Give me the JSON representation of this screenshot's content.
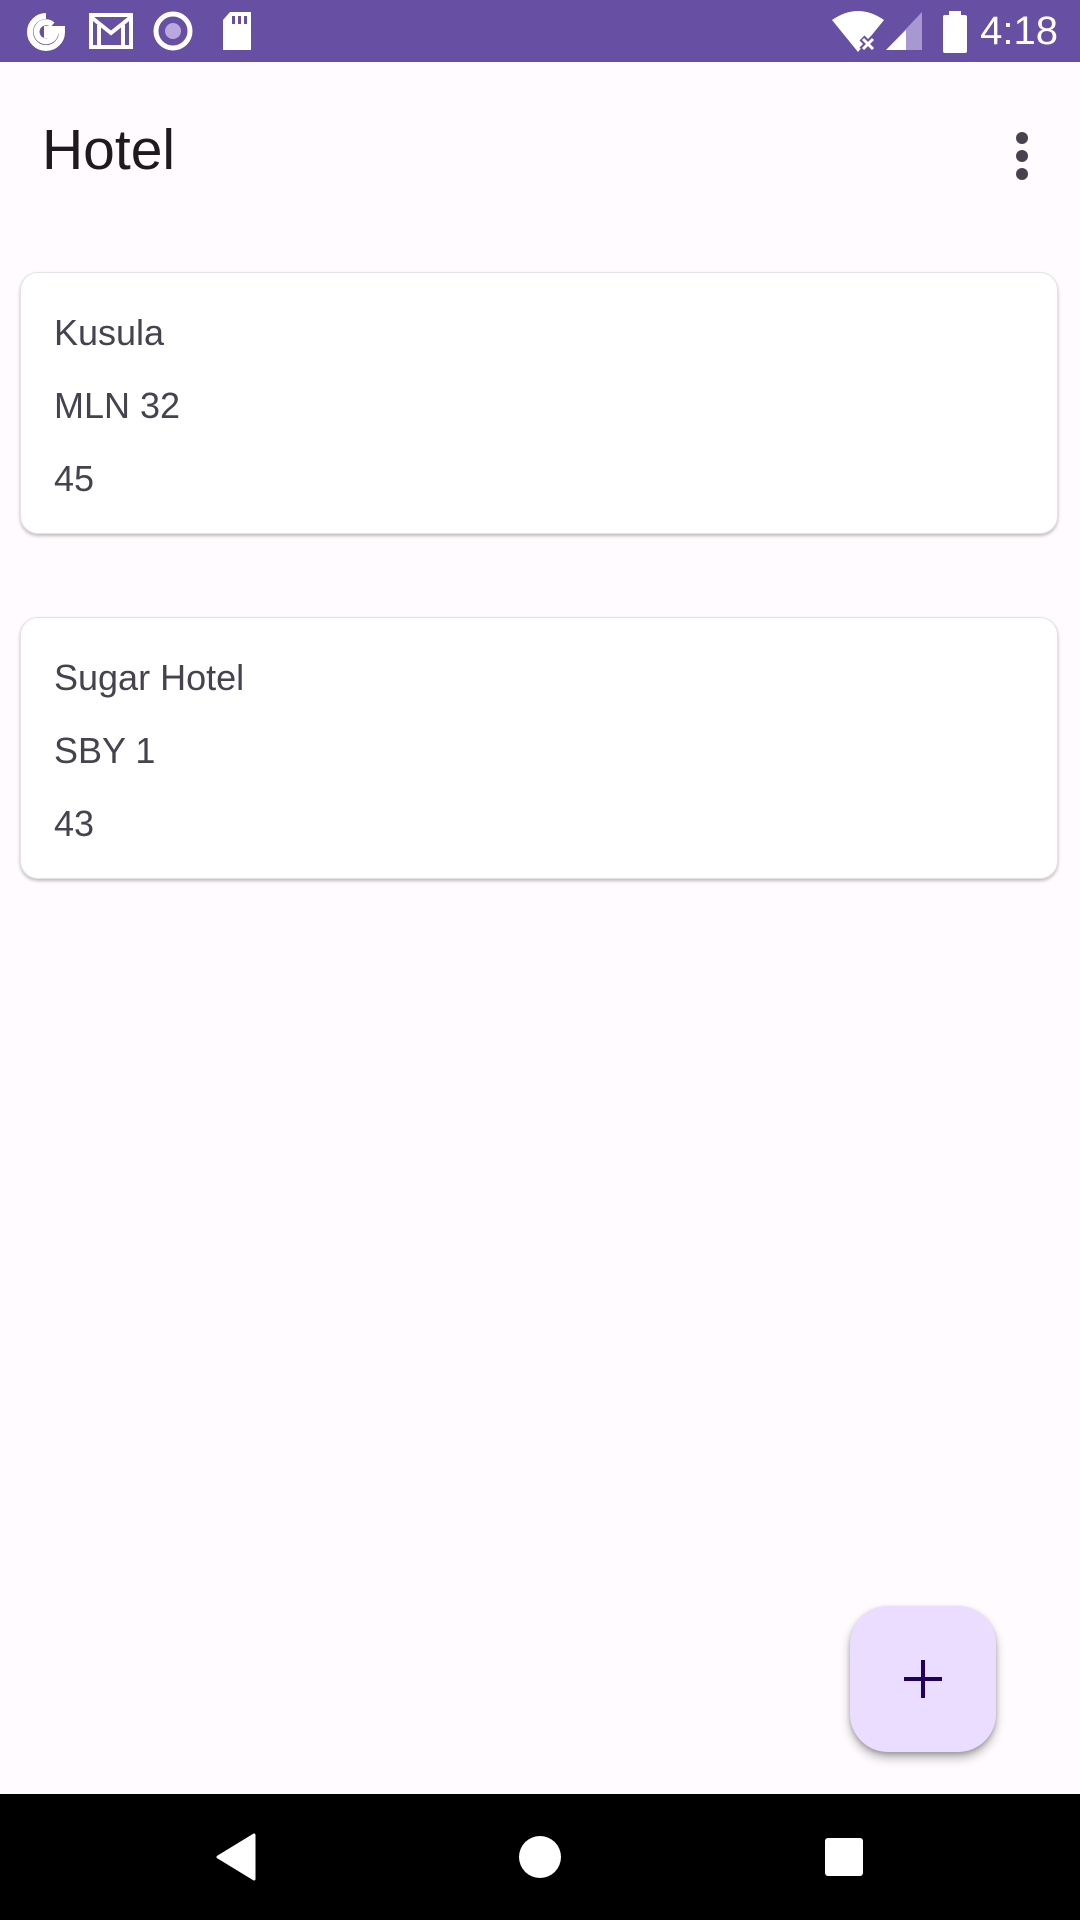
{
  "status_bar": {
    "time": "4:18",
    "left_icons": [
      "google-icon",
      "gmail-icon",
      "radio-icon",
      "sd-card-icon"
    ],
    "right_icons": [
      "wifi-icon",
      "signal-icon",
      "battery-icon"
    ],
    "background": "#6750a4"
  },
  "app_bar": {
    "title": "Hotel",
    "overflow_icon": "more-vert-icon"
  },
  "hotels": [
    {
      "name": "Kusula",
      "address": "MLN 32",
      "value": "45"
    },
    {
      "name": "Sugar Hotel",
      "address": "SBY 1",
      "value": "43"
    }
  ],
  "fab": {
    "icon": "plus-icon",
    "background": "#eaddff"
  },
  "nav_bar": {
    "icons": [
      "back-icon",
      "home-icon",
      "recents-icon"
    ]
  },
  "colors": {
    "surface": "#fffbfe",
    "primary": "#6750a4",
    "on_surface_variant": "#46434f"
  }
}
